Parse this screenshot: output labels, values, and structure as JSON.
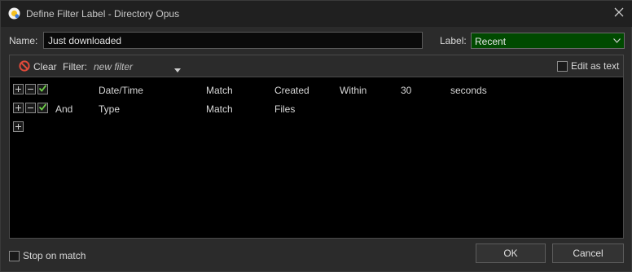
{
  "window": {
    "title": "Define Filter Label - Directory Opus",
    "icons": {
      "app": "directory-opus-icon",
      "close": "close-icon"
    }
  },
  "name_field": {
    "label": "Name:",
    "value": "Just downloaded"
  },
  "label_field": {
    "label": "Label:",
    "value": "Recent",
    "color": "#004a00"
  },
  "toolbar": {
    "clear_label": "Clear",
    "filter_label": "Filter:",
    "filter_placeholder": "new filter",
    "edit_as_text_label": "Edit as text",
    "edit_as_text_checked": false
  },
  "rules": [
    {
      "expander": "+",
      "checked": true,
      "conjunction": "",
      "field": "Date/Time",
      "op": "Match",
      "value": "Created",
      "extra1": "Within",
      "extra2": "30",
      "extra3": "seconds"
    },
    {
      "expander": "+",
      "checked": true,
      "conjunction": "And",
      "field": "Type",
      "op": "Match",
      "value": "Files",
      "extra1": "",
      "extra2": "",
      "extra3": ""
    }
  ],
  "add_row_symbol": "+",
  "footer": {
    "stop_on_match_label": "Stop on match",
    "stop_on_match_checked": false,
    "ok_label": "OK",
    "cancel_label": "Cancel"
  }
}
